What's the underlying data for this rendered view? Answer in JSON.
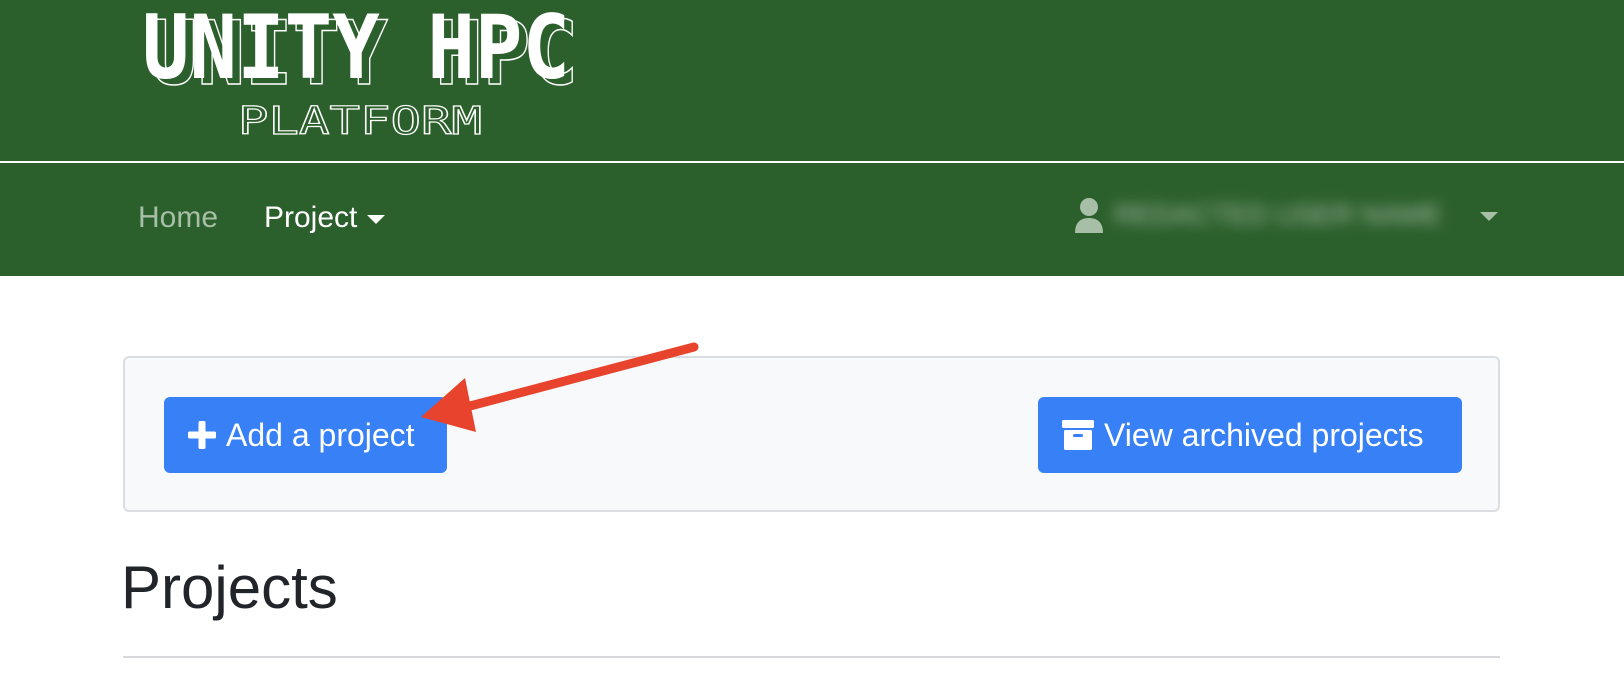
{
  "header": {
    "logo_title": "UNITY HPC",
    "logo_subtitle": "PLATFORM"
  },
  "navbar": {
    "home_label": "Home",
    "project_label": "Project",
    "user_name": "REDACTED USER NAME"
  },
  "toolbar": {
    "add_label": "Add a project",
    "archive_label": "View archived projects"
  },
  "main": {
    "heading": "Projects"
  },
  "colors": {
    "brand_green": "#2b5f2b",
    "primary_button": "#3880f5",
    "annotation_arrow": "#e8432d"
  },
  "icons": {
    "add": "plus-icon",
    "archive": "archive-box-icon",
    "user": "user-icon",
    "dropdown": "caret-down-icon"
  }
}
